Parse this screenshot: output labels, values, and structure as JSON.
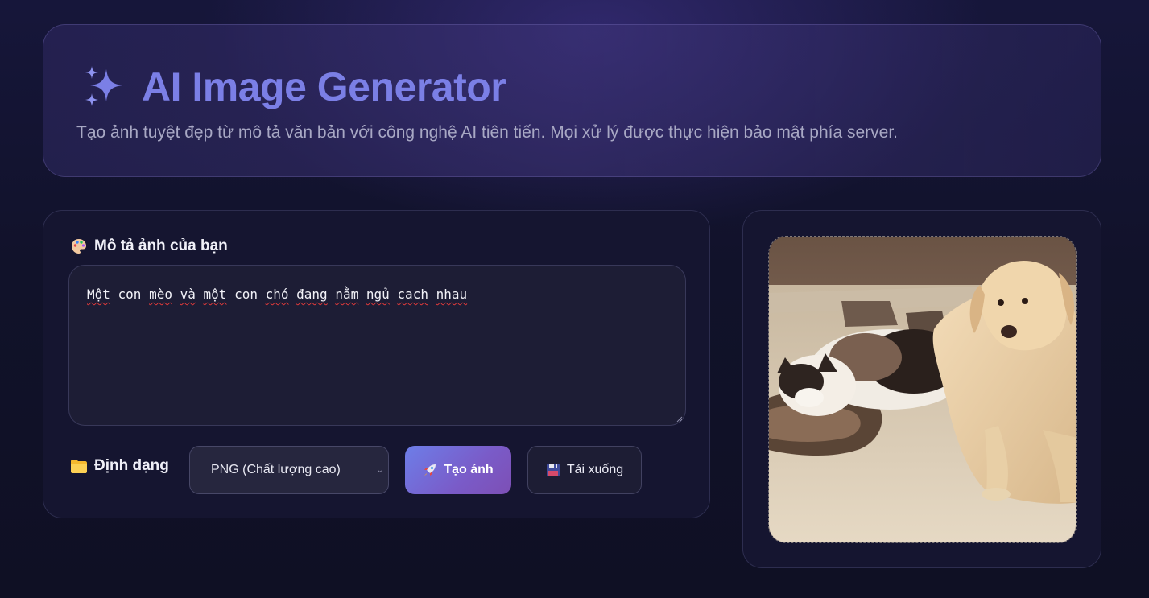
{
  "header": {
    "title": "AI Image Generator",
    "subtitle": "Tạo ảnh tuyệt đẹp từ mô tả văn bản với công nghệ AI tiên tiến. Mọi xử lý được thực hiện bảo mật phía server.",
    "icon": "sparkles-icon"
  },
  "form": {
    "prompt_label": "Mô tả ảnh của bạn",
    "prompt_icon": "palette-icon",
    "prompt_value": "Một con mèo và một con chó đang nằm ngủ cach nhau",
    "format_label": "Định dạng",
    "format_icon": "folder-icon",
    "format_selected": "PNG (Chất lượng cao)",
    "create_label": "Tạo ảnh",
    "create_icon": "rocket-icon",
    "download_label": "Tải xuống",
    "download_icon": "floppy-disk-icon"
  },
  "colors": {
    "accent": "#7b7fe6",
    "button_gradient_start": "#6d7ee8",
    "button_gradient_end": "#7d4fb5",
    "background": "#11122a"
  },
  "preview": {
    "image_subject": "generated-image"
  }
}
